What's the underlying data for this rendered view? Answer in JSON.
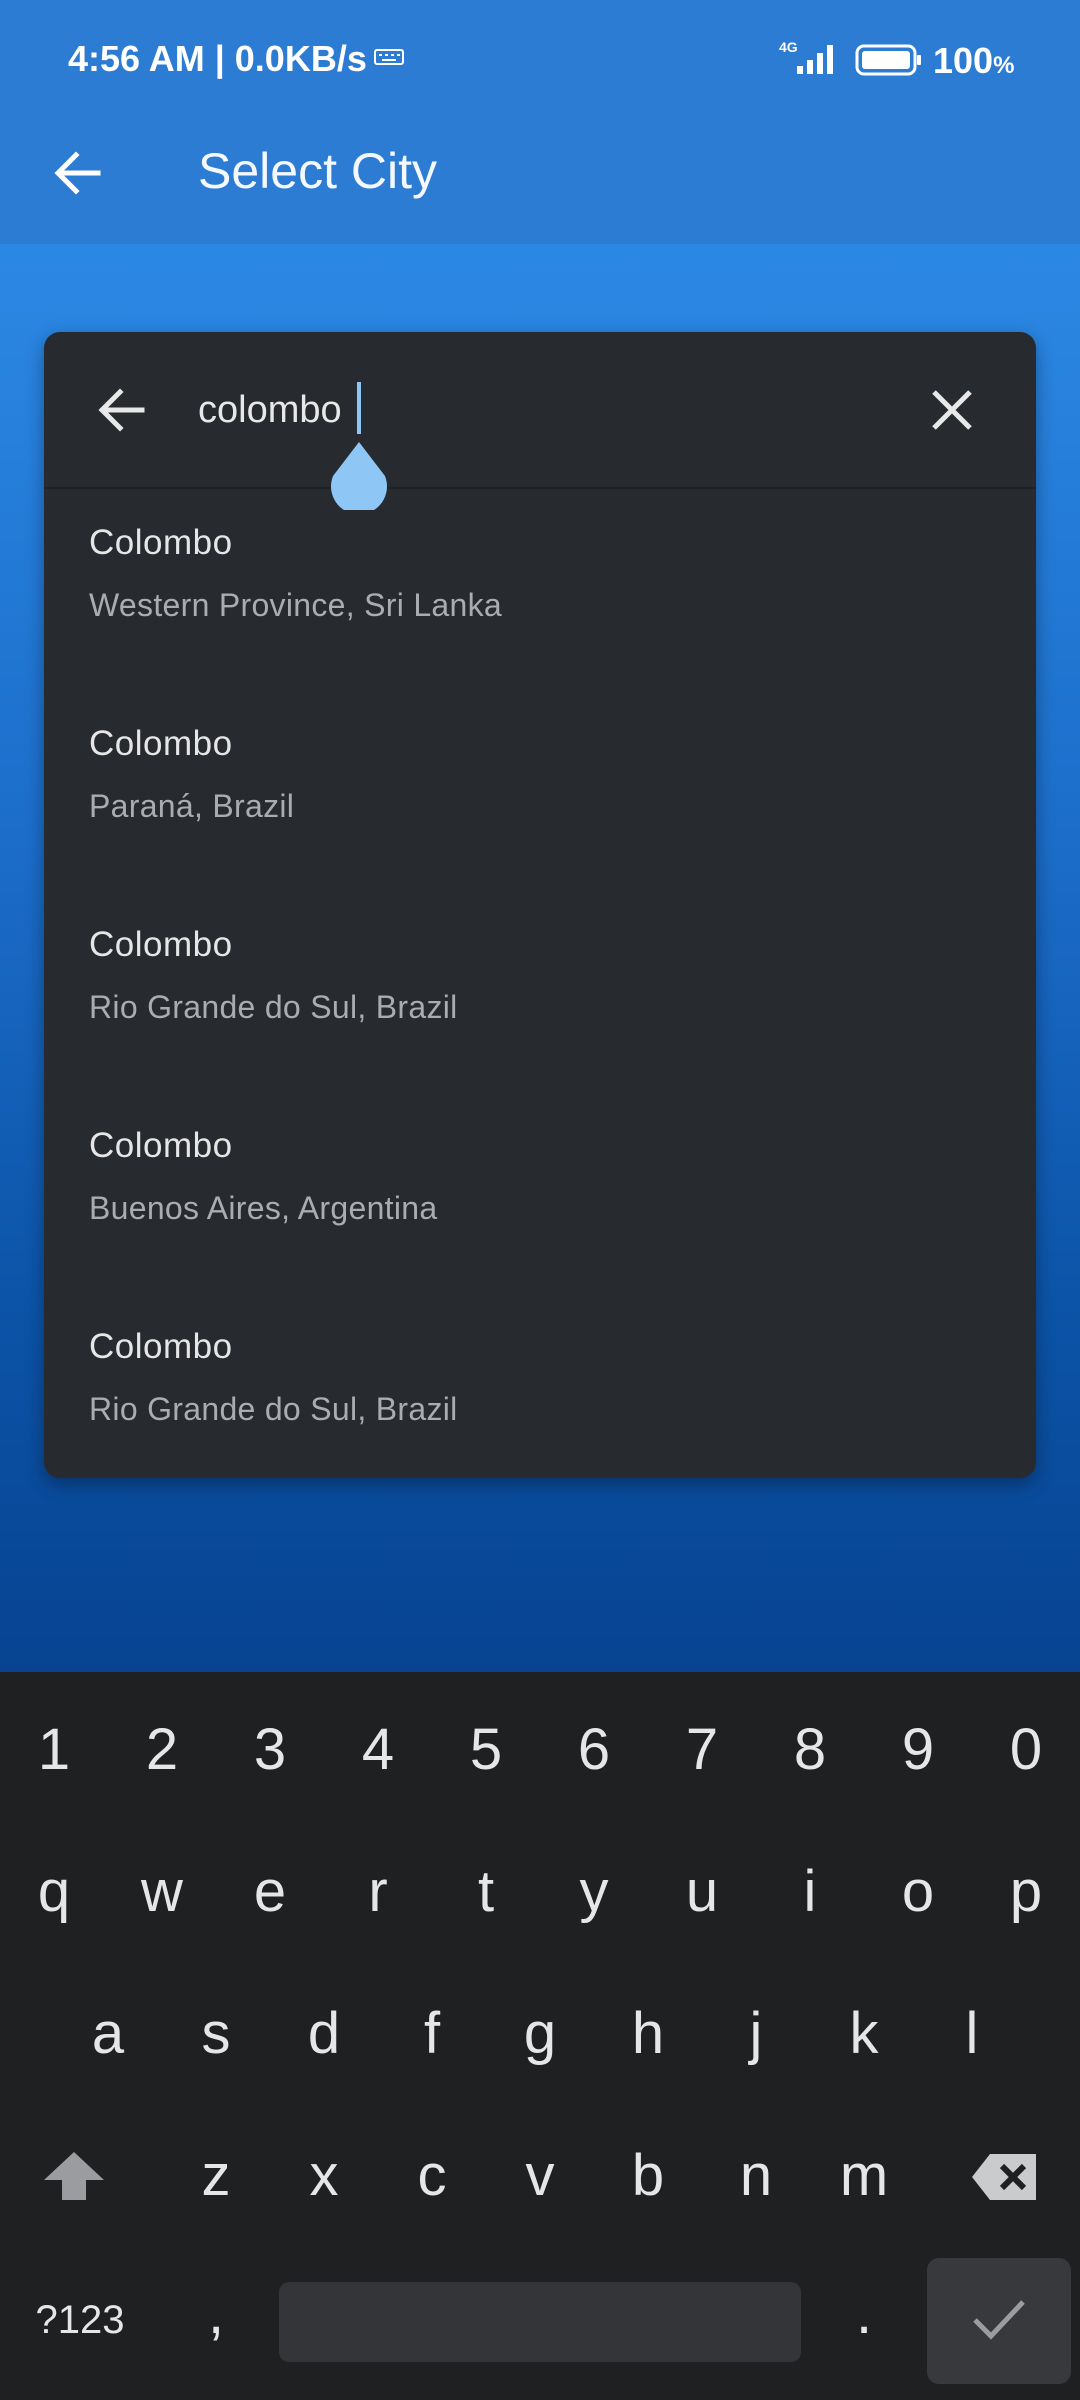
{
  "status_bar": {
    "time_speed": "4:56 AM | 0.0KB/s",
    "network": "4G",
    "battery": "100",
    "battery_unit": "%"
  },
  "app_bar": {
    "title": "Select City"
  },
  "search": {
    "query": "colombo"
  },
  "results": [
    {
      "title": "Colombo",
      "subtitle": "Western Province, Sri Lanka"
    },
    {
      "title": "Colombo",
      "subtitle": "Paraná, Brazil"
    },
    {
      "title": "Colombo",
      "subtitle": "Rio Grande do Sul, Brazil"
    },
    {
      "title": "Colombo",
      "subtitle": "Buenos Aires, Argentina"
    },
    {
      "title": "Colombo",
      "subtitle": "Rio Grande do Sul, Brazil"
    }
  ],
  "keyboard": {
    "number_row": [
      "1",
      "2",
      "3",
      "4",
      "5",
      "6",
      "7",
      "8",
      "9",
      "0"
    ],
    "row1": [
      "q",
      "w",
      "e",
      "r",
      "t",
      "y",
      "u",
      "i",
      "o",
      "p"
    ],
    "row2": [
      "a",
      "s",
      "d",
      "f",
      "g",
      "h",
      "j",
      "k",
      "l"
    ],
    "row3": [
      "z",
      "x",
      "c",
      "v",
      "b",
      "n",
      "m"
    ],
    "symbols_label": "?123",
    "comma_label": ",",
    "period_label": "."
  },
  "icons": {
    "back": "arrow-left-icon",
    "clear": "close-icon",
    "shift": "shift-icon",
    "backspace": "backspace-icon",
    "enter": "check-icon"
  },
  "colors": {
    "app_bar": "#2d7cd3",
    "card": "#272a2e",
    "keyboard": "#1f2022",
    "caret": "#8ec7f5"
  }
}
